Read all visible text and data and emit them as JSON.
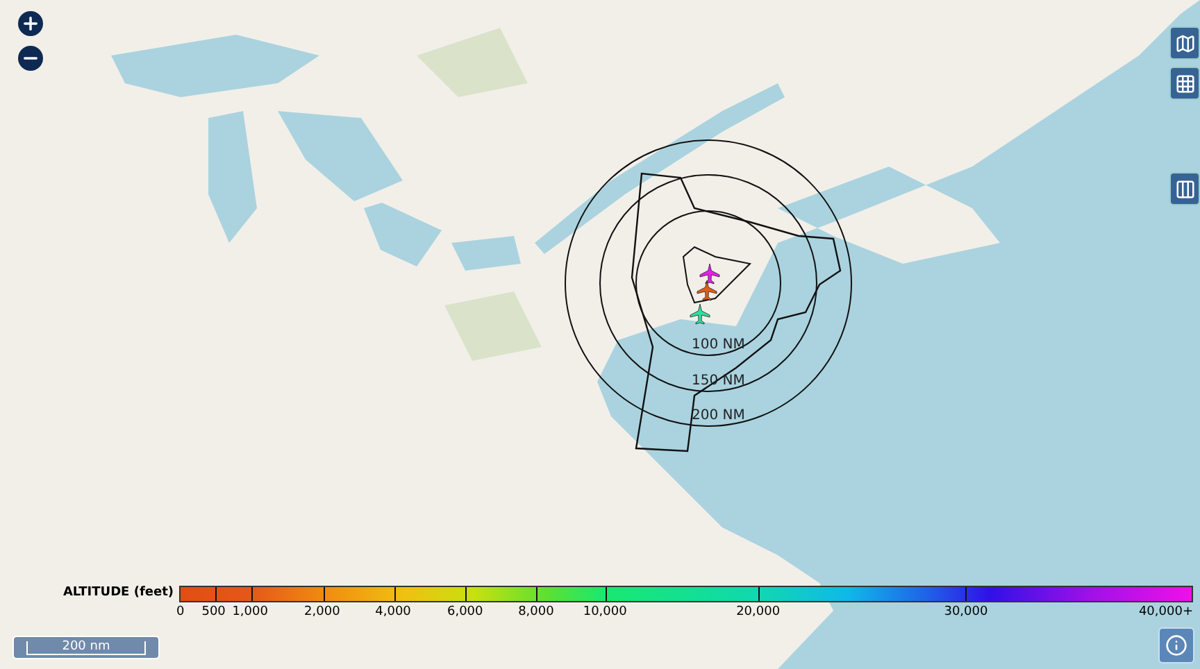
{
  "range_rings": [
    {
      "label": "100 NM"
    },
    {
      "label": "150 NM"
    },
    {
      "label": "200 NM"
    }
  ],
  "aircraft": [
    {
      "color": "#e81ee8"
    },
    {
      "color": "#e0601a"
    },
    {
      "color": "#2ee0a0"
    }
  ],
  "altitude_legend": {
    "title": "ALTITUDE (feet)",
    "stops": [
      "0",
      "500",
      "1,000",
      "2,000",
      "4,000",
      "6,000",
      "8,000",
      "10,000",
      "20,000",
      "30,000",
      "40,000+"
    ]
  },
  "scale_bar": {
    "label": "200 nm"
  }
}
